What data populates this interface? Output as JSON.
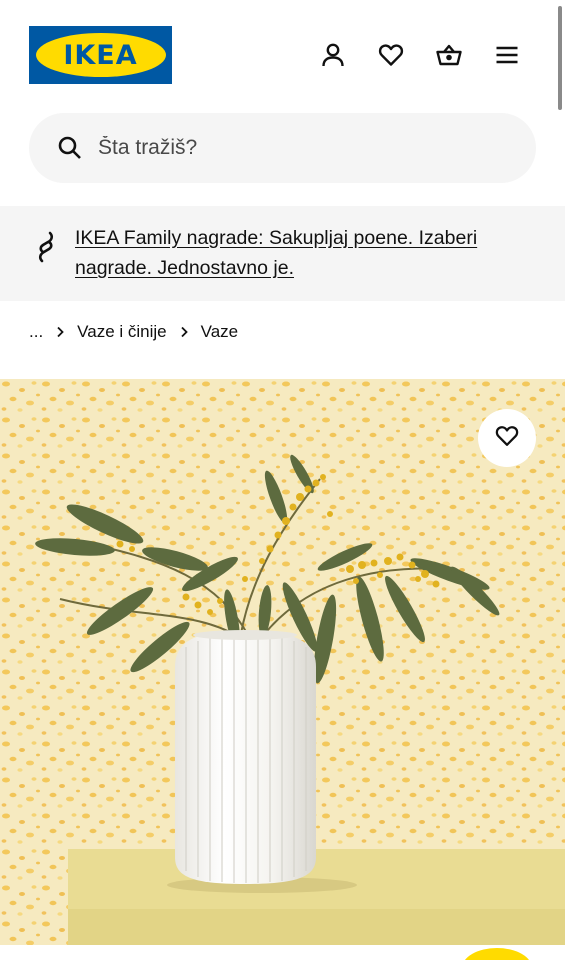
{
  "header": {
    "logo_text": "IKEA",
    "icons": [
      "profile-icon",
      "heart-icon",
      "basket-icon",
      "hamburger-menu-icon"
    ]
  },
  "search": {
    "placeholder": "Šta tražiš?",
    "value": ""
  },
  "banner": {
    "icon": "ikea-family-icon",
    "text": "IKEA Family nagrade: Sakupljaj poene. Izaberi nagrade. Jednostavno je."
  },
  "breadcrumb": {
    "items": [
      "...",
      "Vaze i činije",
      "Vaze"
    ]
  },
  "product_image": {
    "description_icon": "favourite-heart-icon"
  },
  "colors": {
    "ikea_blue": "#0058a3",
    "ikea_yellow": "#ffdb00",
    "surface_grey": "#f5f5f5",
    "text": "#111111"
  }
}
